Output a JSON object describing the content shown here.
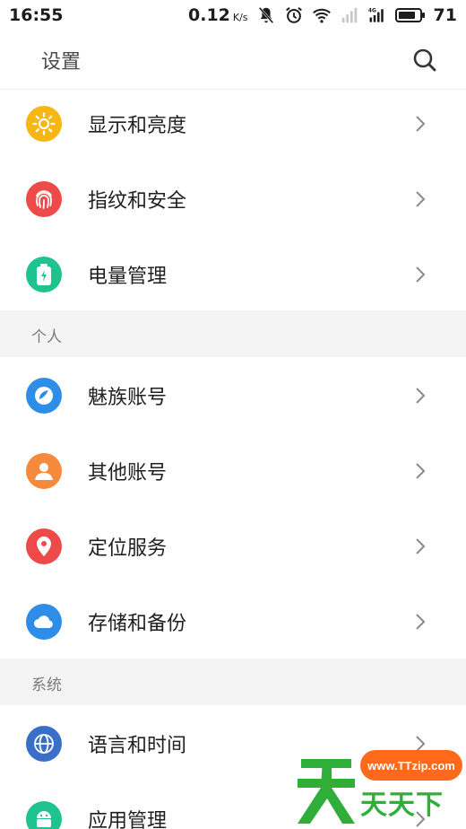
{
  "status_bar": {
    "time": "16:55",
    "network_speed": "0.12",
    "network_speed_unit": "K/s",
    "battery_level": "71",
    "network_type": "4G"
  },
  "header": {
    "title": "设置"
  },
  "sections": {
    "personal": "个人",
    "system": "系统"
  },
  "items": [
    {
      "label": "显示和亮度",
      "icon": "sun-icon",
      "color": "#f6b614"
    },
    {
      "label": "指纹和安全",
      "icon": "fingerprint-icon",
      "color": "#ef4a4a"
    },
    {
      "label": "电量管理",
      "icon": "battery-icon",
      "color": "#1fc38e"
    },
    {
      "label": "魅族账号",
      "icon": "meizu-account-icon",
      "color": "#2e8de6"
    },
    {
      "label": "其他账号",
      "icon": "person-icon",
      "color": "#f58a3c"
    },
    {
      "label": "定位服务",
      "icon": "location-pin-icon",
      "color": "#ee4a4a"
    },
    {
      "label": "存储和备份",
      "icon": "cloud-icon",
      "color": "#2e8de6"
    },
    {
      "label": "语言和时间",
      "icon": "globe-icon",
      "color": "#3a6fc9"
    },
    {
      "label": "应用管理",
      "icon": "android-icon",
      "color": "#1fc38e"
    }
  ],
  "watermark": {
    "site": "www.TTzip.com",
    "brand": "天天下載"
  }
}
